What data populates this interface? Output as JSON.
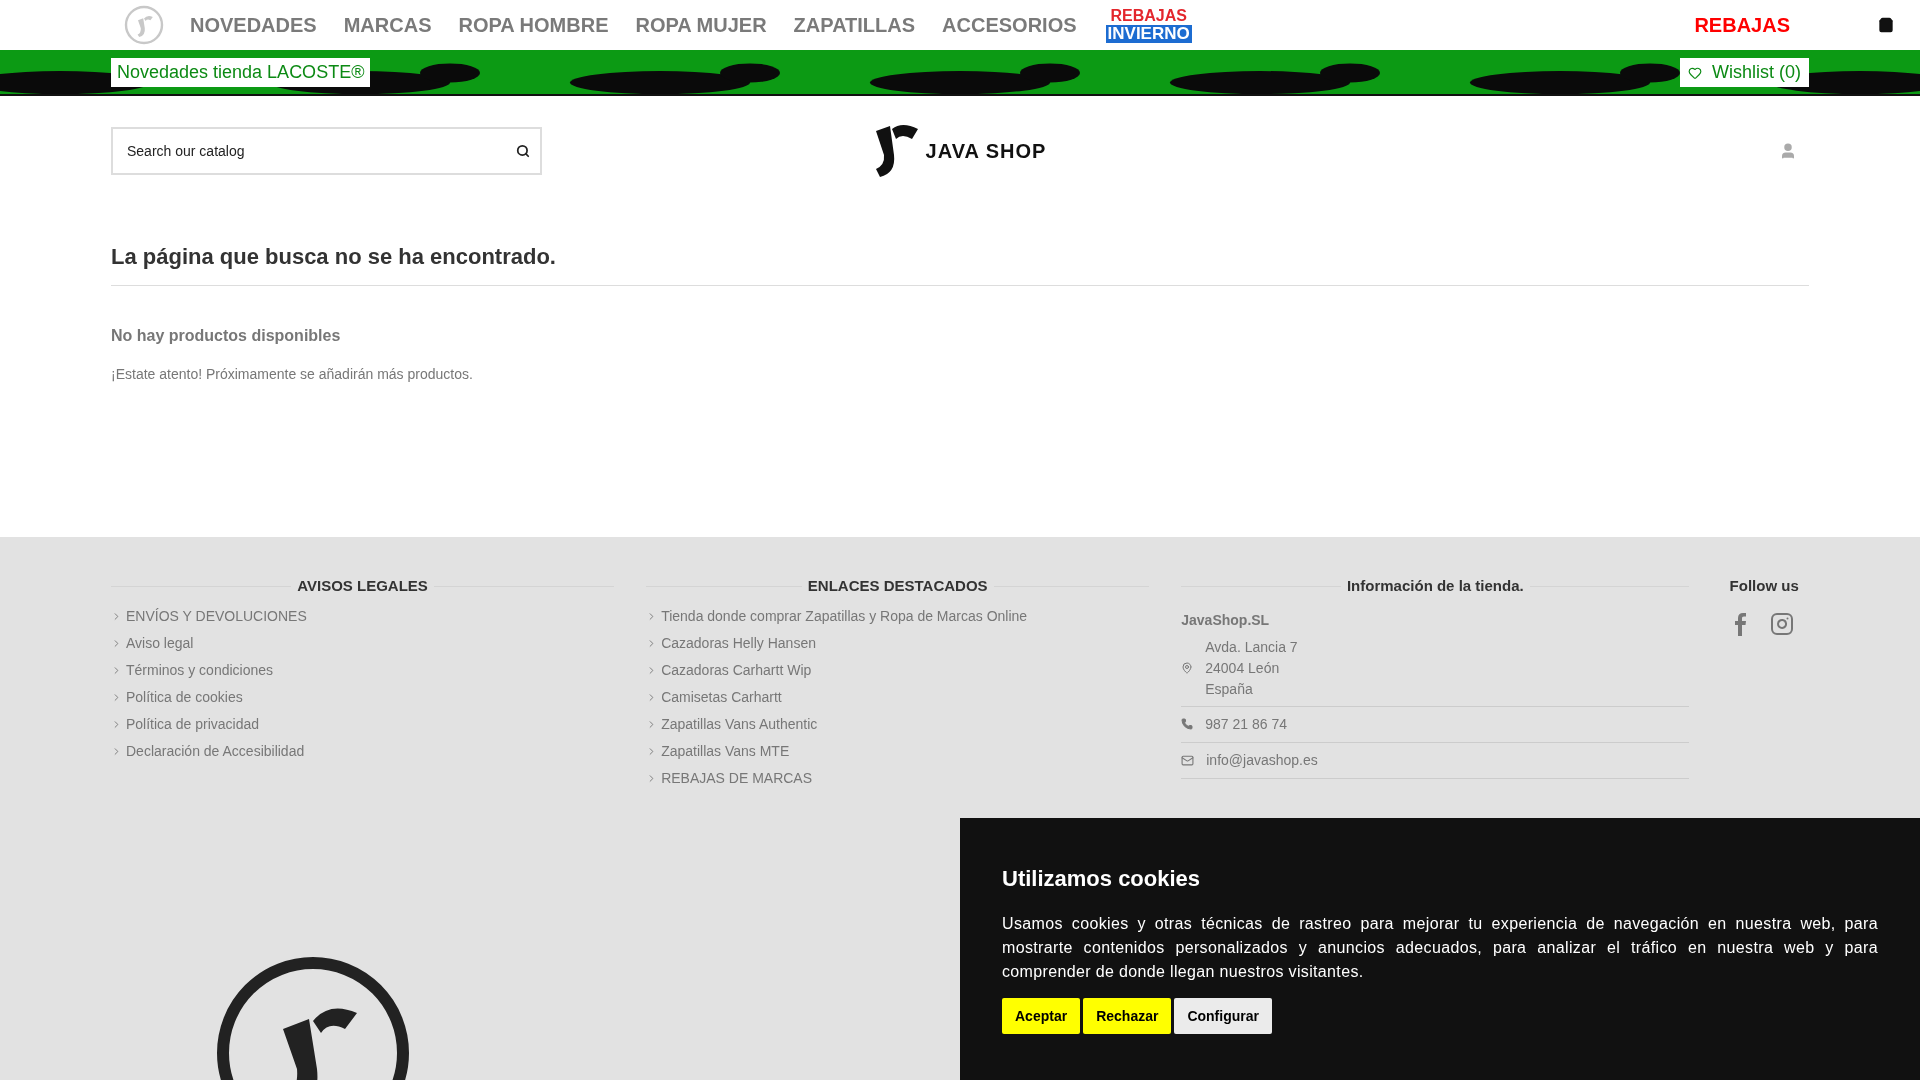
{
  "nav": {
    "items": [
      {
        "kind": "text",
        "label": "NOVEDADES"
      },
      {
        "kind": "text",
        "label": "MARCAS"
      },
      {
        "kind": "text",
        "label": "ROPA HOMBRE"
      },
      {
        "kind": "text",
        "label": "ROPA MUJER"
      },
      {
        "kind": "text",
        "label": "ZAPATILLAS"
      },
      {
        "kind": "text",
        "label": "ACCESORIOS"
      },
      {
        "kind": "promo",
        "lines": [
          "REBAJAS",
          "INVIERNO"
        ]
      }
    ],
    "sale": "REBAJAS"
  },
  "banner": {
    "text": "Novedades tienda LACOSTE®",
    "wishlist": "Wishlist (0)"
  },
  "header": {
    "search": {
      "placeholder": "Search our catalog"
    },
    "logo": "JAVA SHOP"
  },
  "page": {
    "title": "La página que busca no se ha encontrado.",
    "subtitle": "No hay productos disponibles",
    "message": "¡Estate atento! Próximamente se añadirán más productos."
  },
  "footer": {
    "legal": {
      "title": "AVISOS LEGALES",
      "links": [
        "ENVÍOS Y DEVOLUCIONES",
        "Aviso legal",
        "Términos y condiciones",
        "Política de cookies",
        "Política de privacidad",
        "Declaración de Accesibilidad"
      ]
    },
    "featured": {
      "title": "ENLACES DESTACADOS",
      "links": [
        "Tienda donde comprar Zapatillas y Ropa de Marcas Online",
        "Cazadoras Helly Hansen",
        "Cazadoras Carhartt Wip",
        "Camisetas Carhartt",
        "Zapatillas Vans Authentic",
        "Zapatillas Vans MTE",
        "REBAJAS DE MARCAS"
      ]
    },
    "store": {
      "title": "Información de la tienda.",
      "name": "JavaShop.SL",
      "address": [
        "Avda. Lancia 7",
        "24004 León",
        "España"
      ],
      "phone": "987 21 86 74",
      "email": "info@javashop.es"
    },
    "follow": {
      "title": "Follow us"
    }
  },
  "cookies": {
    "title": "Utilizamos cookies",
    "text": "Usamos cookies y otras técnicas de rastreo para mejorar tu experiencia de navegación en nuestra web, para mostrarte contenidos personalizados y anuncios adecuados, para analizar el tráfico en nuestra web y para comprender de donde llegan nuestros visitantes.",
    "buttons": [
      {
        "kind": "accept",
        "label": "Aceptar"
      },
      {
        "kind": "reject",
        "label": "Rechazar"
      },
      {
        "kind": "config",
        "label": "Configurar"
      }
    ]
  }
}
